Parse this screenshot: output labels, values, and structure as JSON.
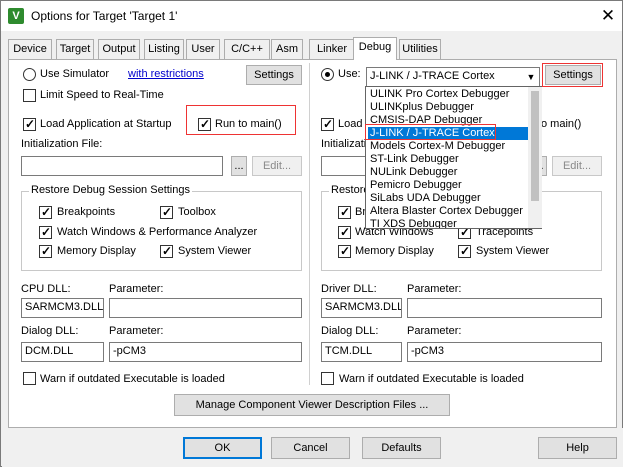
{
  "window": {
    "title": "Options for Target 'Target 1'",
    "app_icon": "V"
  },
  "tabs": [
    "Device",
    "Target",
    "Output",
    "Listing",
    "User",
    "C/C++",
    "Asm",
    "Linker",
    "Debug",
    "Utilities"
  ],
  "left": {
    "use_simulator_label": "Use Simulator",
    "restrictions_link": "with restrictions",
    "settings_label": "Settings",
    "limit_speed_label": "Limit Speed to Real-Time",
    "load_app_label": "Load Application at Startup",
    "run_to_main_label": "Run to main()",
    "init_file_label": "Initialization File:",
    "browse_label": "...",
    "edit_label": "Edit...",
    "restore_group_title": "Restore Debug Session Settings",
    "breakpoints_label": "Breakpoints",
    "toolbox_label": "Toolbox",
    "watch_windows_label": "Watch Windows & Performance Analyzer",
    "memory_display_label": "Memory Display",
    "system_viewer_label": "System Viewer",
    "cpu_dll_label": "CPU DLL:",
    "cpu_param_label": "Parameter:",
    "cpu_dll_value": "SARMCM3.DLL",
    "cpu_param_value": "",
    "dialog_dll_label": "Dialog DLL:",
    "dialog_param_label": "Parameter:",
    "dialog_dll_value": "DCM.DLL",
    "dialog_param_value": "-pCM3",
    "warn_label": "Warn if outdated Executable is loaded"
  },
  "right": {
    "use_label": "Use:",
    "debugger_selected": "J-LINK / J-TRACE Cortex",
    "settings_label": "Settings",
    "load_app_label_partial": "Load",
    "run_to_main_partial": "o main()",
    "init_file_label": "Initialization",
    "browse_label": "...",
    "edit_label": "Edit...",
    "restore_group_title_partial": "Restore",
    "breakpoints_partial": "Brea",
    "watch_windows_partial": "Watch Windows",
    "tracepoints_label": "Tracepoints",
    "memory_display_label": "Memory Display",
    "system_viewer_label": "System Viewer",
    "driver_dll_label": "Driver DLL:",
    "driver_param_label": "Parameter:",
    "driver_dll_value": "SARMCM3.DLL",
    "driver_param_value": "",
    "dialog_dll_label": "Dialog DLL:",
    "dialog_param_label": "Parameter:",
    "dialog_dll_value": "TCM.DLL",
    "dialog_param_value": "-pCM3",
    "warn_label": "Warn if outdated Executable is loaded"
  },
  "debugger_options": [
    "ULINK Pro Cortex Debugger",
    "ULINKplus Debugger",
    "CMSIS-DAP Debugger",
    "J-LINK / J-TRACE Cortex",
    "Models Cortex-M Debugger",
    "ST-Link Debugger",
    "NULink Debugger",
    "Pemicro Debugger",
    "SiLabs UDA Debugger",
    "Altera Blaster Cortex Debugger",
    "TI XDS Debugger"
  ],
  "manage_button": "Manage Component Viewer Description Files ...",
  "footer": {
    "ok": "OK",
    "cancel": "Cancel",
    "defaults": "Defaults",
    "help": "Help"
  },
  "colors": {
    "highlight": "#0078d7",
    "annotation": "#e33333",
    "link": "#0000cc"
  }
}
